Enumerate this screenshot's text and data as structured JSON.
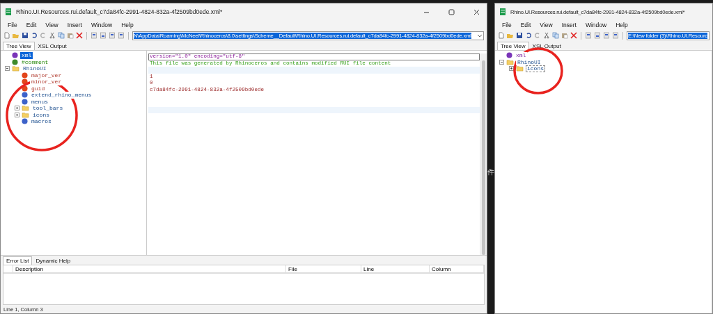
{
  "background": {
    "fragment": "件"
  },
  "main_window": {
    "title": "Rhino.UI.Resources.rui.default_c7da84fc-2991-4824-832a-4f2509bd0ede.xml*",
    "menu": [
      "File",
      "Edit",
      "View",
      "Insert",
      "Window",
      "Help"
    ],
    "path": "N\\AppData\\Roaming\\McNeel\\Rhinoceros\\8.0\\settings\\Scheme__Default\\Rhino.UI.Resources.rui.default_c7da84fc-2991-4824-832a-4f2509bd0ede.xml",
    "tabs": [
      {
        "label": "Tree View",
        "selected": true
      },
      {
        "label": "XSL Output",
        "selected": false
      }
    ],
    "tree": [
      {
        "kind": "declaration",
        "label": "xml",
        "selected": true
      },
      {
        "kind": "comment",
        "label": "#comment",
        "selected": false
      },
      {
        "kind": "folder",
        "label": "RhinoUI",
        "selected": false,
        "expanded": true,
        "children": [
          {
            "kind": "text",
            "label": "major_ver",
            "selected": false
          },
          {
            "kind": "text",
            "label": "minor_ver",
            "selected": false
          },
          {
            "kind": "text",
            "label": "guid",
            "selected": false
          },
          {
            "kind": "element",
            "label": "extend_rhino_menus",
            "selected": false
          },
          {
            "kind": "element",
            "label": "menus",
            "selected": false
          },
          {
            "kind": "folder",
            "label": "tool_bars",
            "selected": false,
            "expanded": false
          },
          {
            "kind": "folder",
            "label": "icons",
            "selected": false,
            "expanded": false
          },
          {
            "kind": "element",
            "label": "macros",
            "selected": false
          }
        ]
      }
    ],
    "lines": [
      {
        "kind": "declaration",
        "text": "version=\"1.0\" encoding=\"utf-8\""
      },
      {
        "kind": "comment",
        "text": "This file was generated by Rhinoceros and contains modified RUI file content"
      },
      {
        "kind": "blank"
      },
      {
        "kind": "value",
        "text": "1"
      },
      {
        "kind": "value",
        "text": "0"
      },
      {
        "kind": "value",
        "text": "c7da84fc-2991-4824-832a-4f2509bd0ede"
      },
      {
        "kind": "blank"
      },
      {
        "kind": "blank"
      },
      {
        "kind": "blank"
      }
    ],
    "bottom_tabs": [
      {
        "label": "Error List",
        "selected": true
      },
      {
        "label": "Dynamic Help",
        "selected": false
      }
    ],
    "error_columns": [
      "Description",
      "File",
      "Line",
      "Column"
    ],
    "status_bar": "Line 1, Column 3"
  },
  "second_window": {
    "title": "Rhino.UI.Resources.rui.default_c7da84fc-2991-4824-832a-4f2509bd0ede.xml*",
    "menu": [
      "File",
      "Edit",
      "View",
      "Insert",
      "Window",
      "Help"
    ],
    "path": "E:\\New folder (3)\\Rhino.UI.Resourc",
    "tabs": [
      {
        "label": "Tree View",
        "selected": true
      },
      {
        "label": "XSL Output",
        "selected": false
      }
    ],
    "tree": [
      {
        "kind": "declaration",
        "label": "xml",
        "selected": false
      },
      {
        "kind": "folder",
        "label": "RhinoUI",
        "selected": false,
        "expanded": true,
        "children": [
          {
            "kind": "folder",
            "label": "icons",
            "selected": true,
            "expanded": false
          }
        ]
      }
    ]
  }
}
